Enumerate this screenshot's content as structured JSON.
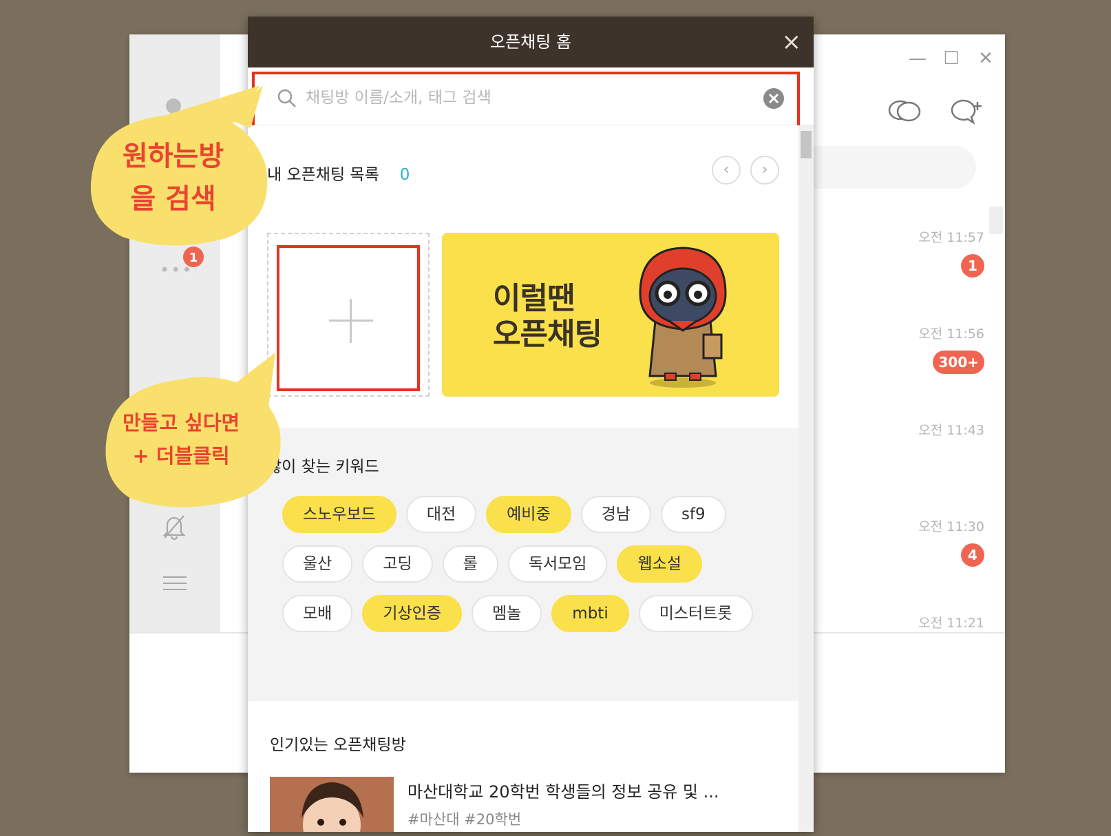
{
  "background_window": {
    "window_controls": [
      "—",
      "☐",
      "✕"
    ],
    "sidebar_badge": "1",
    "chat_list": [
      {
        "time": "오전 11:57",
        "badge": "1"
      },
      {
        "time": "오전 11:56",
        "badge": "300+"
      },
      {
        "time": "오전 11:43",
        "badge": ""
      },
      {
        "time": "오전 11:30",
        "badge": "4"
      },
      {
        "time": "오전 11:21",
        "badge": ""
      }
    ]
  },
  "popup": {
    "title": "오픈채팅 홈",
    "close_label": "×",
    "search": {
      "placeholder": "채팅방 이름/소개, 태그 검색"
    },
    "my_list": {
      "title": "내 오픈채팅 목록",
      "count": "0",
      "prev": "‹",
      "next": "›"
    },
    "banner": {
      "line1": "이럴땐",
      "line2": "오픈채팅"
    },
    "keywords": {
      "title": "많이 찾는 키워드",
      "items": [
        {
          "label": "스노우보드",
          "highlight": true
        },
        {
          "label": "대전",
          "highlight": false
        },
        {
          "label": "예비중",
          "highlight": true
        },
        {
          "label": "경남",
          "highlight": false
        },
        {
          "label": "sf9",
          "highlight": false
        },
        {
          "label": "울산",
          "highlight": false
        },
        {
          "label": "고딩",
          "highlight": false
        },
        {
          "label": "롤",
          "highlight": false
        },
        {
          "label": "독서모임",
          "highlight": false
        },
        {
          "label": "웹소설",
          "highlight": true
        },
        {
          "label": "모배",
          "highlight": false
        },
        {
          "label": "기상인증",
          "highlight": true
        },
        {
          "label": "멤놀",
          "highlight": false
        },
        {
          "label": "mbti",
          "highlight": true
        },
        {
          "label": "미스터트롯",
          "highlight": false
        }
      ]
    },
    "popular": {
      "title": "인기있는 오픈채팅방",
      "room_title": "마산대학교 20학번 학생들의 정보 공유 및 ...",
      "room_tags": "#마산대 #20학번"
    }
  },
  "callouts": {
    "search_tip": {
      "line1": "원하는방",
      "line2": "을 검색"
    },
    "create_tip": {
      "line1": "만들고 싶다면",
      "line2": "+ 더블클릭"
    }
  },
  "colors": {
    "highlight": "#e5341f",
    "kakao_yellow": "#fae04a",
    "header": "#3d332b",
    "badge": "#f06552"
  }
}
